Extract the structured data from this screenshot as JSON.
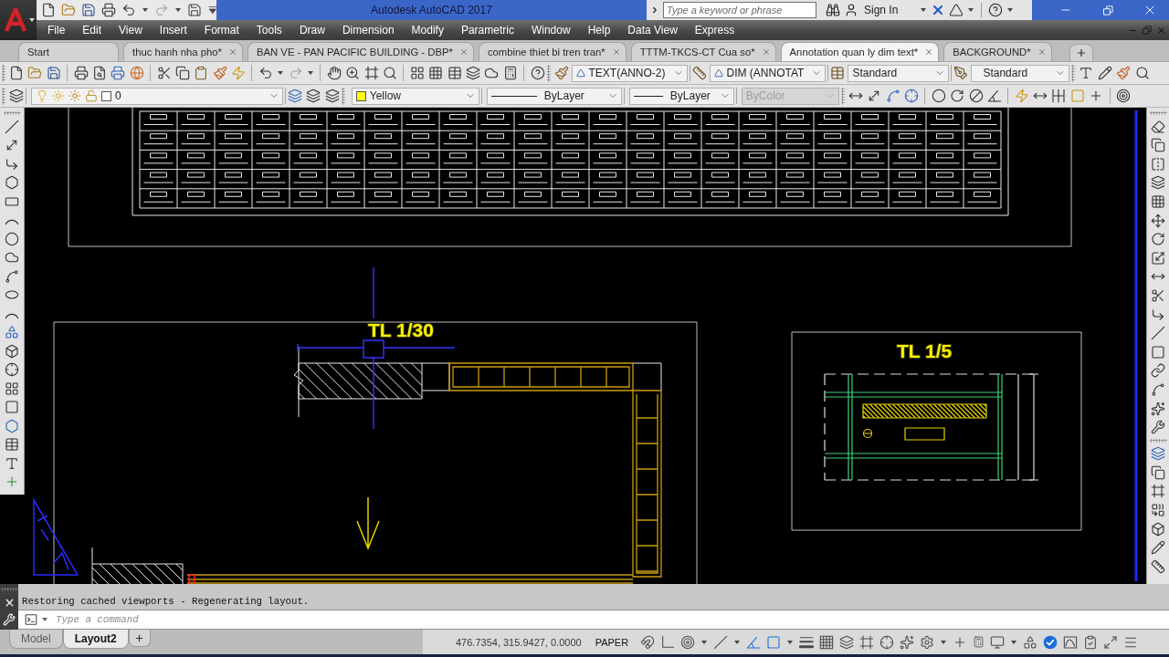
{
  "title_bar": {
    "title": "Autodesk AutoCAD 2017",
    "search": {
      "placeholder": "Type a keyword or phrase"
    },
    "sign_in": "Sign In"
  },
  "menu_bar": [
    "File",
    "Edit",
    "View",
    "Insert",
    "Format",
    "Tools",
    "Draw",
    "Dimension",
    "Modify",
    "Parametric",
    "Window",
    "Help",
    "Data View",
    "Express"
  ],
  "file_tabs": [
    {
      "label": "Start",
      "kind": "start",
      "selected": false
    },
    {
      "label": "thuc hanh nha pho*",
      "kind": "document",
      "selected": false
    },
    {
      "label": "BAN VE - PAN PACIFIC BUILDING - DBP*",
      "kind": "document",
      "selected": false
    },
    {
      "label": "combine thiet bi tren tran*",
      "kind": "document",
      "selected": false
    },
    {
      "label": "TTTM-TKCS-CT Cua so*",
      "kind": "document",
      "selected": false
    },
    {
      "label": "Annotation quan ly dim text*",
      "kind": "document",
      "selected": true
    },
    {
      "label": "BACKGROUND*",
      "kind": "document",
      "selected": false
    }
  ],
  "styles_toolbar": {
    "text_style": "TEXT(ANNO-2)",
    "dim_style": "DIM (ANNOTAT",
    "table_style": "Standard",
    "multileader_style": "Standard"
  },
  "layers_toolbar": {
    "layer": {
      "name": "0",
      "on": true,
      "frozen": false,
      "viewport_frozen": false,
      "locked": false
    }
  },
  "properties_toolbar": {
    "current_colour": "Yellow",
    "linetype": "ByLayer",
    "lineweight": "ByLayer",
    "plot_style": {
      "value": "ByColor",
      "disabled": true
    }
  },
  "drawing": {
    "scale_labels": [
      "TL 1/30",
      "TL 1/5"
    ]
  },
  "command_line": {
    "history": "Restoring cached viewports - Regenerating layout.",
    "input": {
      "placeholder": "Type a command"
    }
  },
  "layout_tabs": [
    {
      "label": "Model",
      "selected": false
    },
    {
      "label": "Layout2",
      "selected": true
    }
  ],
  "status_bar": {
    "coordinates": "476.7354, 315.9427, 0.0000",
    "space": "PAPER",
    "toggles": [
      {
        "on": false
      },
      {
        "on": false
      },
      {
        "on": false
      },
      {
        "on": false
      },
      {
        "on": true
      },
      {
        "on": true
      },
      {
        "on": false
      },
      {
        "on": false
      },
      {
        "on": false
      },
      {
        "on": false
      },
      {
        "on": false
      },
      {
        "on": false
      }
    ],
    "performance_toggle": {
      "on": true
    }
  }
}
